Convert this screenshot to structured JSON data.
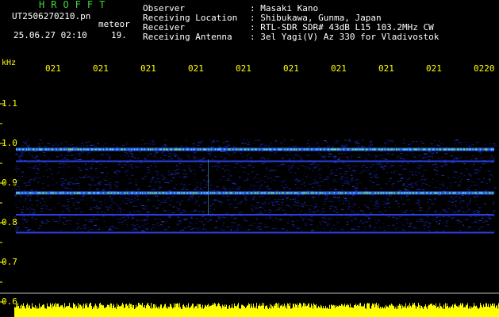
{
  "header": {
    "app_title": "HROFFT",
    "file_name": "UT2506270210.pn",
    "mode": "meteor",
    "datetime": "25.06.27 02:10",
    "count": "19.",
    "fields": [
      {
        "label": "Observer",
        "value": ": Masaki Kano"
      },
      {
        "label": "Receiving Location",
        "value": ": Shibukawa, Gunma, Japan"
      },
      {
        "label": "Receiver",
        "value": ": RTL-SDR SDR# 43dB L15 103.2MHz CW"
      },
      {
        "label": "Receiving Antenna",
        "value": ": 3el Yagi(V) Az 330 for Vladivostok"
      }
    ]
  },
  "axis": {
    "unit": "kHz",
    "y_labels": [
      "1.1",
      "1.0",
      "0.9",
      "0.8",
      "0.7",
      "0.6"
    ],
    "x_labels": [
      "021",
      "021",
      "021",
      "021",
      "021",
      "021",
      "021",
      "021",
      "021",
      "0220"
    ]
  },
  "colors": {
    "header_text": "#ffffff",
    "title_green": "#41d341",
    "axis_yellow": "#ffff00",
    "signal_blue": "#1a2cc8",
    "signal_green": "#6fe06f",
    "signal_cyan": "#50d0ff"
  },
  "spectrogram": {
    "frequency_range_khz": [
      0.6,
      1.1
    ],
    "horizontal_lines_khz": [
      0.985,
      0.955,
      0.875,
      0.82,
      0.775
    ],
    "brightest_lines_khz": [
      0.985,
      0.875
    ]
  }
}
